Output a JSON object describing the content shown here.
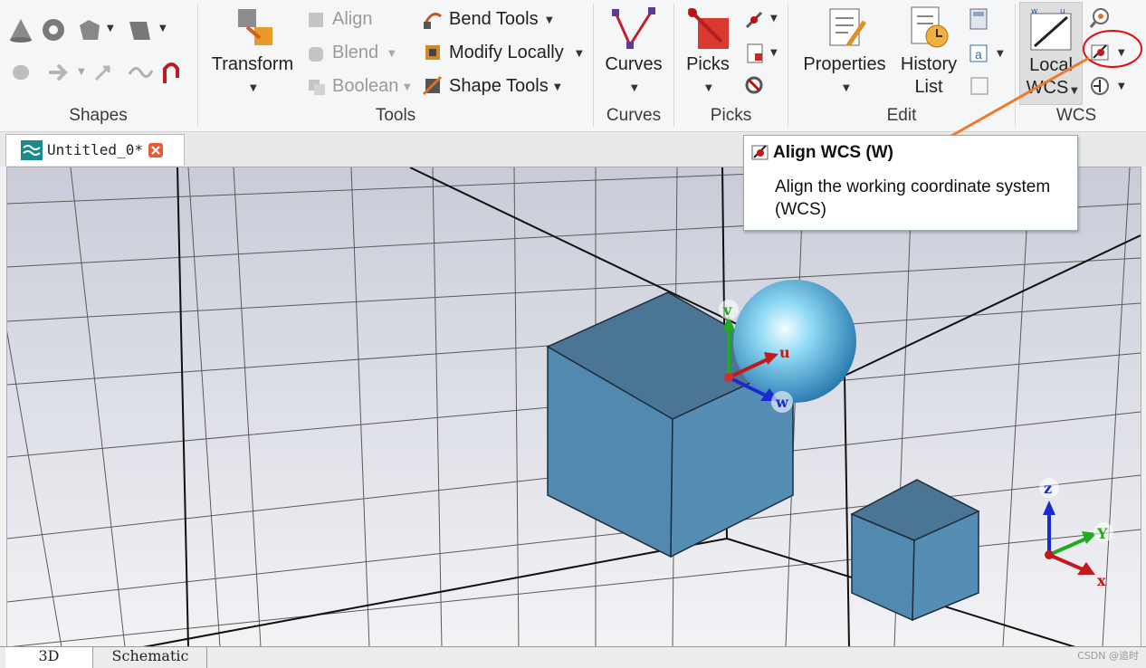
{
  "ribbon": {
    "shapes": {
      "label": "Shapes"
    },
    "tools": {
      "label": "Tools",
      "transform": "Transform",
      "align": "Align",
      "blend": "Blend",
      "boolean": "Boolean",
      "bend_tools": "Bend Tools",
      "modify_locally": "Modify Locally",
      "shape_tools": "Shape Tools"
    },
    "curves": {
      "label": "Curves",
      "button": "Curves"
    },
    "picks": {
      "label": "Picks",
      "button": "Picks"
    },
    "edit": {
      "label": "Edit",
      "properties": "Properties",
      "history_line1": "History",
      "history_line2": "List"
    },
    "wcs": {
      "label": "WCS",
      "local_line1": "Local",
      "local_line2": "WCS"
    }
  },
  "document_tab": {
    "title": "Untitled_0*"
  },
  "tooltip": {
    "title": "Align WCS (W)",
    "description": "Align the working coordinate system (WCS)"
  },
  "viewport": {
    "wcs_axes": {
      "u": "u",
      "v": "v",
      "w": "w"
    },
    "global_axes": {
      "x": "x",
      "y": "Y",
      "z": "z"
    }
  },
  "bottom_tabs": [
    "3D",
    "Schematic"
  ],
  "watermark": "CSDN @追时",
  "colors": {
    "box_face": "#4f84aa",
    "sphere": "#7ecff0",
    "highlight_circle": "#e01010",
    "arrow": "#ee7a2a"
  }
}
